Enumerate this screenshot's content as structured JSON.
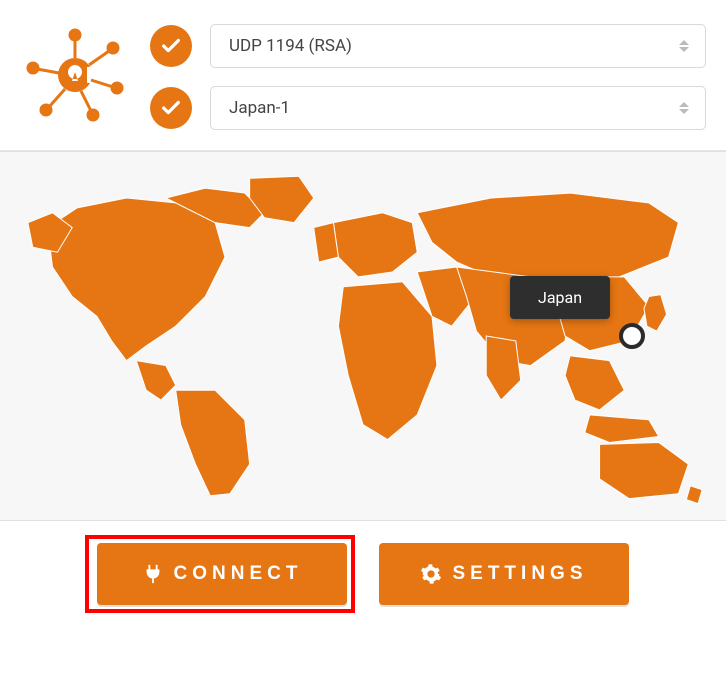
{
  "colors": {
    "accent": "#e67613",
    "tooltip_bg": "#2e2e2e",
    "highlight": "#ff0000"
  },
  "header": {
    "protocol_select": {
      "value": "UDP 1194 (RSA)"
    },
    "server_select": {
      "value": "Japan-1"
    }
  },
  "map": {
    "tooltip_label": "Japan"
  },
  "buttons": {
    "connect_label": "CONNECT",
    "settings_label": "SETTINGS"
  }
}
